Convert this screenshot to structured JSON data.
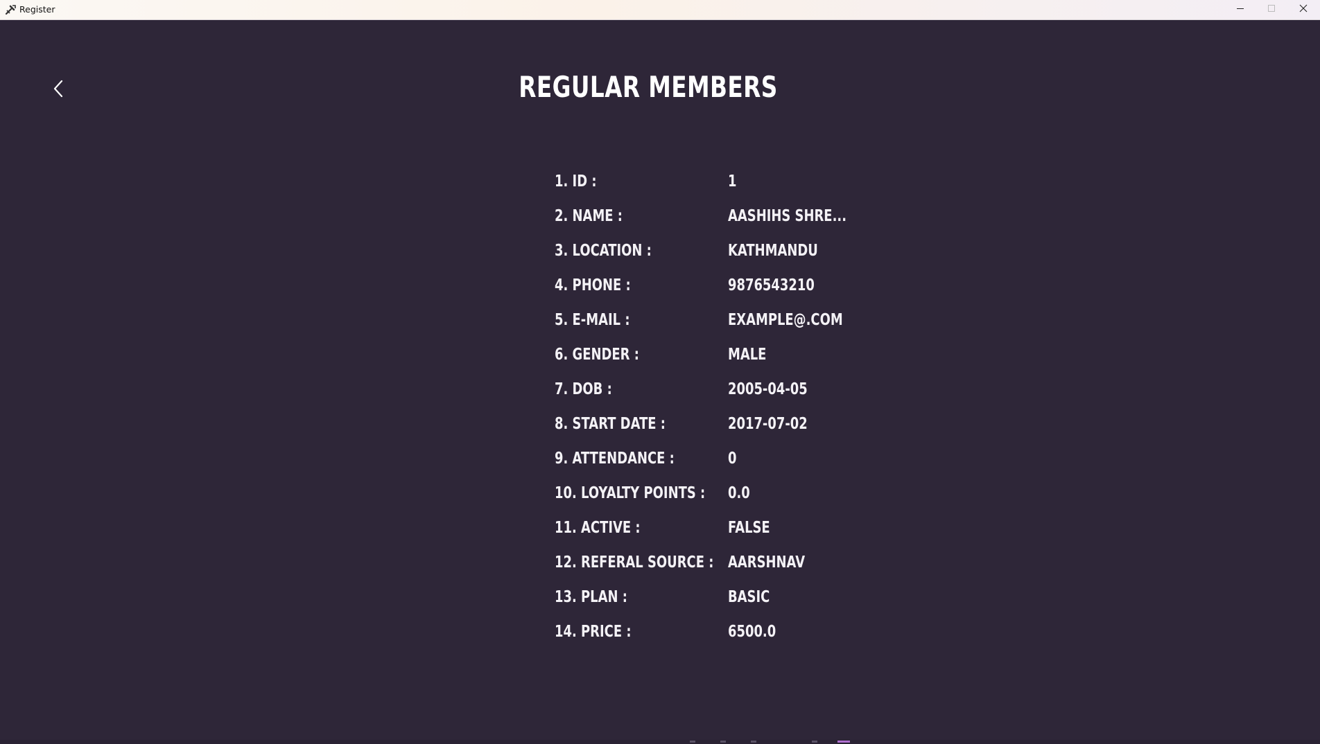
{
  "window": {
    "title": "Register",
    "icon": "tools-icon"
  },
  "page": {
    "title": "REGULAR MEMBERS",
    "back_icon": "chevron-left-icon"
  },
  "details": [
    {
      "label": "1. ID :",
      "value": "1"
    },
    {
      "label": "2. NAME :",
      "value": "AASHIHS SHRE..."
    },
    {
      "label": "3. LOCATION :",
      "value": "KATHMANDU"
    },
    {
      "label": "4. PHONE :",
      "value": "9876543210"
    },
    {
      "label": "5. E-MAIL :",
      "value": "EXAMPLE@.COM"
    },
    {
      "label": "6. GENDER :",
      "value": "MALE"
    },
    {
      "label": "7. DOB :",
      "value": "2005-04-05"
    },
    {
      "label": "8. START DATE :",
      "value": "2017-07-02"
    },
    {
      "label": "9. ATTENDANCE :",
      "value": "0"
    },
    {
      "label": "10. LOYALTY POINTS :",
      "value": "0.0"
    },
    {
      "label": "11. ACTIVE :",
      "value": "FALSE"
    },
    {
      "label": "12. REFERAL SOURCE :",
      "value": "AARSHNAV"
    },
    {
      "label": "13. PLAN :",
      "value": "BASIC"
    },
    {
      "label": "14. PRICE :",
      "value": "6500.0"
    }
  ],
  "colors": {
    "background": "#2e2638",
    "text": "#ffffff",
    "titlebar": "#fbf5ee"
  }
}
